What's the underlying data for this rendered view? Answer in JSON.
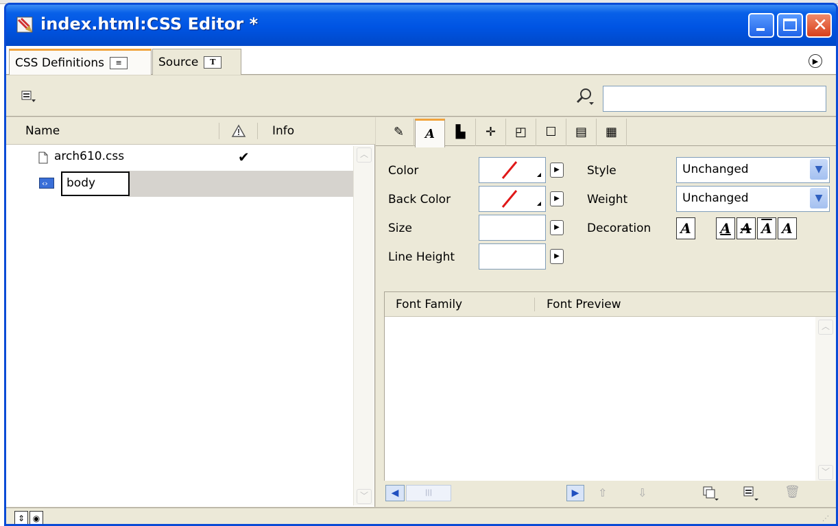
{
  "window": {
    "title": "index.html:CSS Editor *"
  },
  "tabs": [
    {
      "label": "CSS Definitions",
      "icon": "list-icon"
    },
    {
      "label": "Source",
      "icon": "text-icon"
    }
  ],
  "toolbar": {
    "search_placeholder": ""
  },
  "list": {
    "columns": {
      "name": "Name",
      "info": "Info"
    },
    "rows": [
      {
        "name": "arch610.css",
        "icon": "file-icon",
        "check": "✔"
      },
      {
        "name": "body",
        "icon": "style-icon",
        "check": ""
      }
    ]
  },
  "properties": {
    "color_label": "Color",
    "back_color_label": "Back Color",
    "size_label": "Size",
    "line_height_label": "Line Height",
    "style_label": "Style",
    "style_value": "Unchanged",
    "weight_label": "Weight",
    "weight_value": "Unchanged",
    "decoration_label": "Decoration",
    "decoration_glyph": "A"
  },
  "font_table": {
    "col_family": "Font Family",
    "col_preview": "Font Preview"
  },
  "colors": {
    "titlebar": "#0054e3",
    "tab_accent": "#f1a33c",
    "selected_row": "#d6d3ce"
  }
}
